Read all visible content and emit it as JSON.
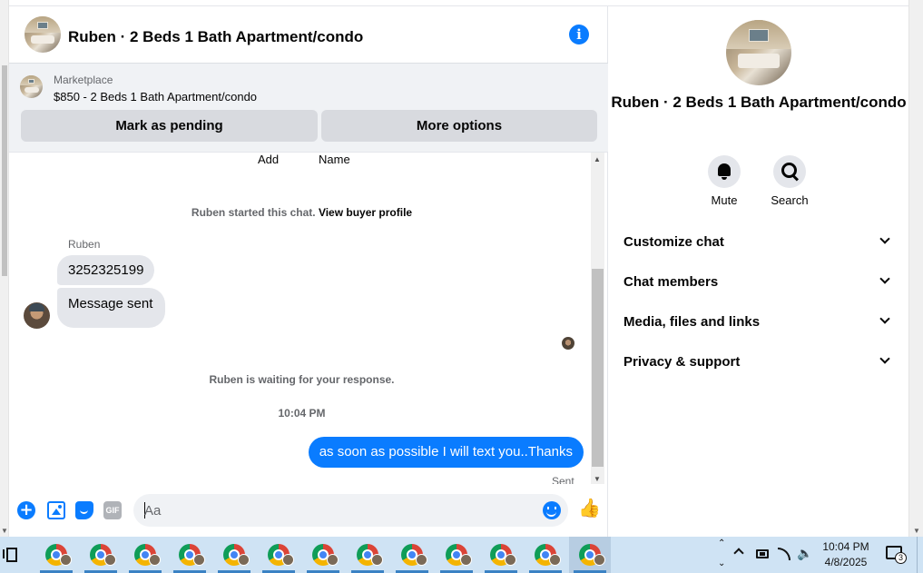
{
  "header": {
    "title": "Ruben · 2 Beds 1 Bath Apartment/condo"
  },
  "marketplace": {
    "label": "Marketplace",
    "listing": "$850 - 2 Beds 1 Bath Apartment/condo",
    "buttons": {
      "pending": "Mark as pending",
      "more": "More options"
    }
  },
  "messages": {
    "add_label": "Add",
    "name_label": "Name",
    "started_text": "Ruben started this chat.",
    "view_profile_link": "View buyer profile",
    "sender_name": "Ruben",
    "incoming": [
      "3252325199",
      "Message sent"
    ],
    "waiting_text": "Ruben is waiting for your response.",
    "time_separator": "10:04 PM",
    "outgoing": "as soon as possible I will text you..Thanks",
    "status": "Sent"
  },
  "composer": {
    "placeholder": "Aa",
    "gif_label": "GIF"
  },
  "info_panel": {
    "title": "Ruben · 2 Beds 1 Bath Apartment/condo",
    "actions": {
      "mute": "Mute",
      "search": "Search"
    },
    "sections": [
      "Customize chat",
      "Chat members",
      "Media, files and links",
      "Privacy & support"
    ]
  },
  "taskbar": {
    "time": "10:04 PM",
    "date": "4/8/2025",
    "notification_count": "3",
    "pinned_apps": [
      "chrome-icon",
      "chrome-icon",
      "chrome-icon",
      "chrome-icon",
      "chrome-icon",
      "chrome-icon",
      "chrome-icon",
      "chrome-icon",
      "chrome-icon",
      "chrome-icon",
      "chrome-icon",
      "chrome-icon",
      "chrome-icon"
    ]
  },
  "colors": {
    "accent": "#0a7cff",
    "bubble_in": "#e4e6eb",
    "taskbar": "#cfe3f4"
  }
}
